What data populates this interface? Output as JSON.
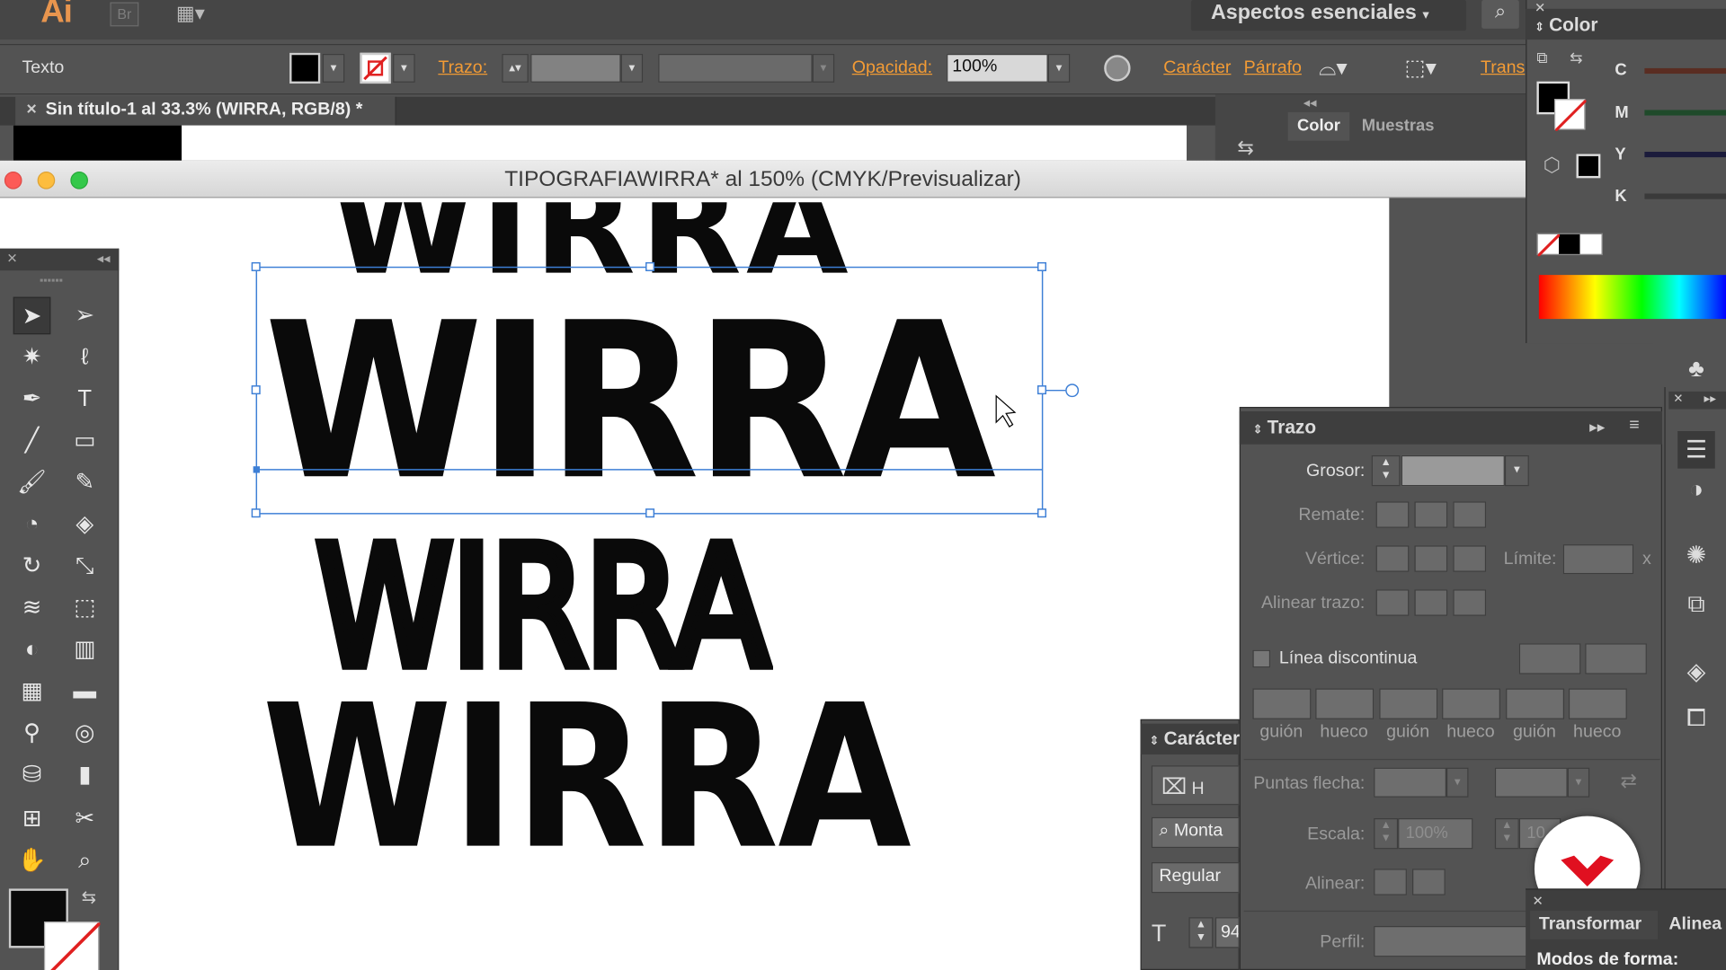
{
  "app": {
    "logo": "Ai",
    "bridge": "Br",
    "workspace": "Aspectos esenciales"
  },
  "control_bar": {
    "mode": "Texto",
    "stroke_label": "Trazo:",
    "opacity_label": "Opacidad:",
    "opacity_value": "100%",
    "caracter_link": "Carácter",
    "parrafo_link": "Párrafo",
    "trans_link": "Trans"
  },
  "doc_tab": {
    "close": "×",
    "title": "Sin título-1 al 33.3% (WIRRA, RGB/8) *"
  },
  "window": {
    "title": "TIPOGRAFIAWIRRA* al 150% (CMYK/Previsualizar)"
  },
  "color_panel_back": {
    "tab_color": "Color",
    "tab_muestras": "Muestras"
  },
  "color_panel": {
    "title": "Color",
    "channels": [
      "C",
      "M",
      "Y",
      "K"
    ],
    "colors": {
      "c": "#5a2d22",
      "m": "#1f4a2a",
      "y": "#1b1b3b",
      "k": "#3a3a3a"
    }
  },
  "artboard_text": {
    "line1": "WIRRA",
    "line2": "WIRRA",
    "line3": "WIRRA",
    "line4": "WIRRA"
  },
  "trazo": {
    "title": "Trazo",
    "grosor": "Grosor:",
    "remate": "Remate:",
    "vertice": "Vértice:",
    "limite": "Límite:",
    "limite_unit": "x",
    "alinear_trazo": "Alinear trazo:",
    "linea_discontinua": "Línea discontinua",
    "dash_labels": [
      "guión",
      "hueco",
      "guión",
      "hueco",
      "guión",
      "hueco"
    ],
    "puntas_flecha": "Puntas flecha:",
    "escala": "Escala:",
    "escala_value": "100%",
    "escala_value2": "10",
    "alinear": "Alinear:",
    "perfil": "Perfil:"
  },
  "caracter": {
    "title": "Carácter",
    "search": "Monta",
    "style": "Regular",
    "size": "94",
    "h": "H"
  },
  "transform_panel": {
    "tab_transformar": "Transformar",
    "tab_alinear": "Alinea",
    "modos": "Modos de forma:"
  }
}
